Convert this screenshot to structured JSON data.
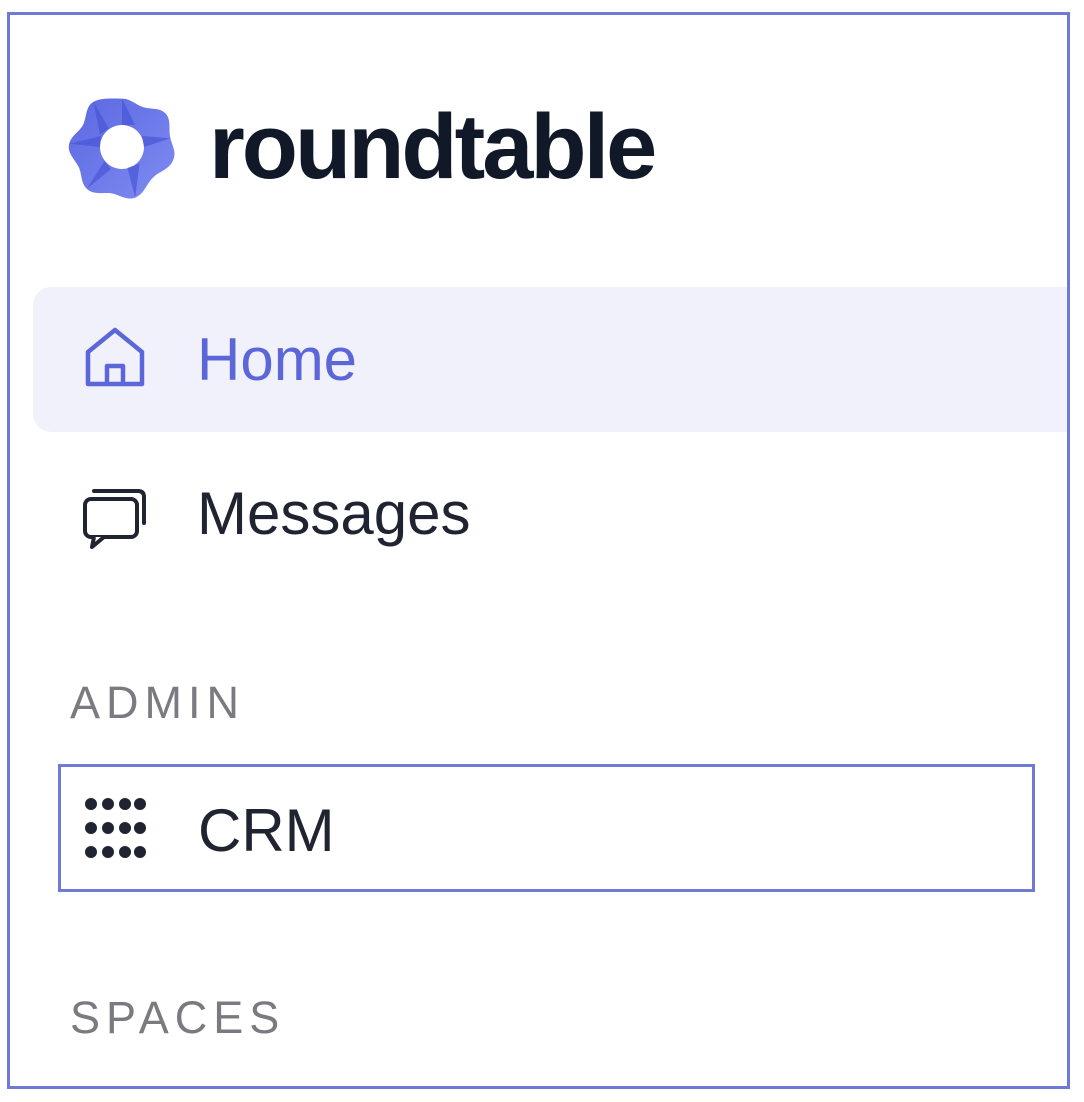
{
  "brand": {
    "name": "roundtable",
    "logo_icon": "roundtable-logo-icon",
    "accent_color": "#5b67d8"
  },
  "nav": {
    "items": [
      {
        "label": "Home",
        "icon": "home-icon",
        "active": true
      },
      {
        "label": "Messages",
        "icon": "messages-icon",
        "active": false
      }
    ]
  },
  "sections": {
    "admin": {
      "title": "ADMIN",
      "items": [
        {
          "label": "CRM",
          "icon": "grid-dots-icon",
          "focused": true
        }
      ]
    },
    "spaces": {
      "title": "SPACES"
    }
  }
}
